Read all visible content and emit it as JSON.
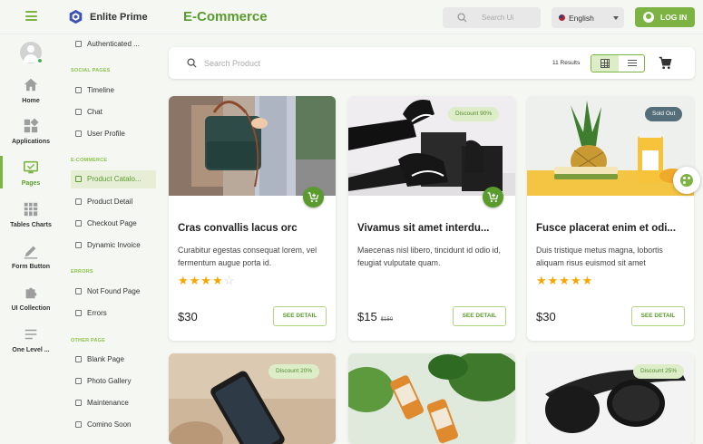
{
  "header": {
    "brand": "Enlite Prime",
    "title": "E-Commerce",
    "search_placeholder": "Search Ui",
    "language": "English",
    "login_label": "LOG IN"
  },
  "rail": [
    {
      "label": "Home",
      "icon": "home-icon"
    },
    {
      "label": "Applications",
      "icon": "apps-icon"
    },
    {
      "label": "Pages",
      "icon": "pages-icon",
      "active": true
    },
    {
      "label": "Tables Charts",
      "icon": "table-icon"
    },
    {
      "label": "Form Button",
      "icon": "pen-icon"
    },
    {
      "label": "UI Collection",
      "icon": "puzzle-icon"
    },
    {
      "label": "One Level ...",
      "icon": "list-icon"
    }
  ],
  "submenu": {
    "top_item": "Authenticated ...",
    "sections": [
      {
        "title": "SOCIAL PAGES",
        "items": [
          "Timeline",
          "Chat",
          "User Profile"
        ]
      },
      {
        "title": "E-COMMERCE",
        "items": [
          "Product Catalo...",
          "Product Detail",
          "Checkout Page",
          "Dynamic Invoice"
        ]
      },
      {
        "title": "ERRORS",
        "items": [
          "Not Found Page",
          "Errors"
        ]
      },
      {
        "title": "OTHER PAGE",
        "items": [
          "Blank Page",
          "Photo Gallery",
          "Maintenance",
          "Comino Soon"
        ]
      }
    ]
  },
  "toolbar": {
    "search_placeholder": "Search Product",
    "results": "11 Results"
  },
  "products": [
    {
      "name": "Cras convallis lacus orc",
      "desc": "Curabitur egestas consequat lorem, vel fermentum augue porta id.",
      "rating": 4,
      "price": "$30",
      "old_price": "",
      "badge": "",
      "detail_label": "SEE DETAIL"
    },
    {
      "name": "Vivamus sit amet interdu...",
      "desc": "Maecenas nisl libero, tincidunt id odio id, feugiat vulputate quam.",
      "rating": 0,
      "price": "$15",
      "old_price": "$150",
      "badge": "Discount 90%",
      "detail_label": "SEE DETAIL"
    },
    {
      "name": "Fusce placerat enim et odi...",
      "desc": "Duis tristique metus magna, lobortis aliquam risus euismod sit amet",
      "rating": 5,
      "price": "$30",
      "old_price": "",
      "badge": "Sold Out",
      "detail_label": "SEE DETAIL"
    },
    {
      "badge": "Discount 20%"
    },
    {
      "badge": ""
    },
    {
      "badge": "Discount 25%"
    }
  ],
  "colors": {
    "accent": "#7cb342",
    "accent_dark": "#5a9b2e",
    "star": "#f7a600",
    "badge_dark": "#546e7a"
  }
}
